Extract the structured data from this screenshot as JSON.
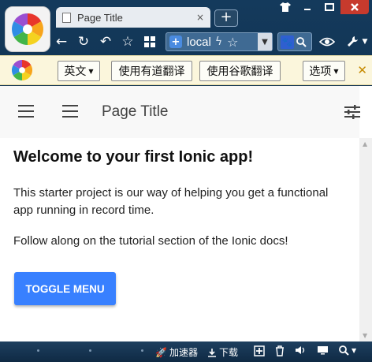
{
  "browser": {
    "tab_title": "Page Title",
    "tab_close": "×",
    "new_tab": "+",
    "url_text": "local",
    "window_controls": {
      "skin": "👕",
      "minimize": "▁",
      "maximize": "□",
      "close": "✕"
    }
  },
  "icons": {
    "logo": "browser-logo-icon",
    "back": "←",
    "reload": "↻",
    "undo": "↶",
    "favorite": "☆",
    "apps": "apps-icon",
    "bolt": "ϟ",
    "star": "☆",
    "dropdown": "▼",
    "search_engine": "paw-icon",
    "search": "search-icon",
    "eye": "eye-icon",
    "wrench": "wrench-icon"
  },
  "translate_bar": {
    "lang_label": "英文",
    "youdao_label": "使用有道翻译",
    "google_label": "使用谷歌翻译",
    "options_label": "选项",
    "close": "✕"
  },
  "app": {
    "page_title": "Page Title",
    "welcome_heading": "Welcome to your first Ionic app!",
    "intro_text": "This starter project is our way of helping you get a functional app running in record time.",
    "tutorial_text": "Follow along on the tutorial section of the Ionic docs!",
    "toggle_menu_label": "TOGGLE MENU",
    "accent_color": "#3880ff"
  },
  "statusbar": {
    "accelerator_label": "加速器",
    "download_label": "下载"
  }
}
